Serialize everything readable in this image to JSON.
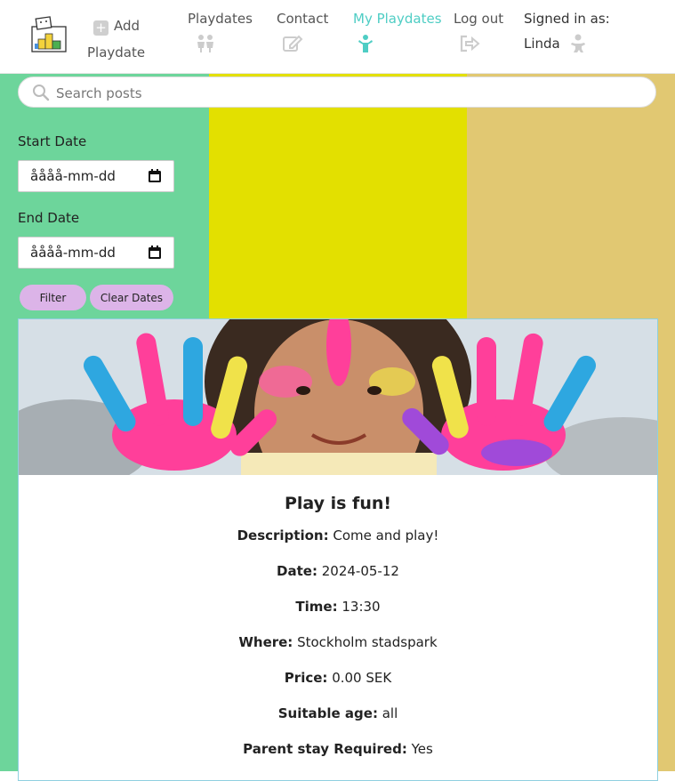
{
  "nav": {
    "add_label": "Add Playdate",
    "playdates_label": "Playdates",
    "contact_label": "Contact",
    "my_playdates_label": "My Playdates",
    "logout_label": "Log out",
    "signed_in_label": "Signed in as:",
    "username": "Linda"
  },
  "search": {
    "placeholder": "Search posts"
  },
  "filter": {
    "start_label": "Start Date",
    "end_label": "End Date",
    "date_format": "åååå-mm-dd",
    "filter_button": "Filter",
    "clear_button": "Clear Dates"
  },
  "post": {
    "title": "Play is fun!",
    "description_label": "Description:",
    "description": "Come and play!",
    "date_label": "Date:",
    "date": "2024-05-12",
    "time_label": "Time:",
    "time": "13:30",
    "where_label": "Where:",
    "where": "Stockholm stadspark",
    "price_label": "Price:",
    "price": "0.00 SEK",
    "age_label": "Suitable age:",
    "age": "all",
    "parent_label": "Parent stay Required:",
    "parent": "Yes"
  },
  "colors": {
    "accent": "#4ecdc4",
    "column_green": "#6dd59b",
    "column_yellow": "#e3e000",
    "column_tan": "#e1c872",
    "button": "#dcb4e8"
  },
  "icons": {
    "add": "plus-square-icon",
    "playdates": "children-icon",
    "contact": "edit-icon",
    "my_playdates": "child-icon",
    "logout": "logout-icon",
    "user": "baby-icon",
    "search": "search-icon",
    "calendar": "calendar-icon"
  }
}
